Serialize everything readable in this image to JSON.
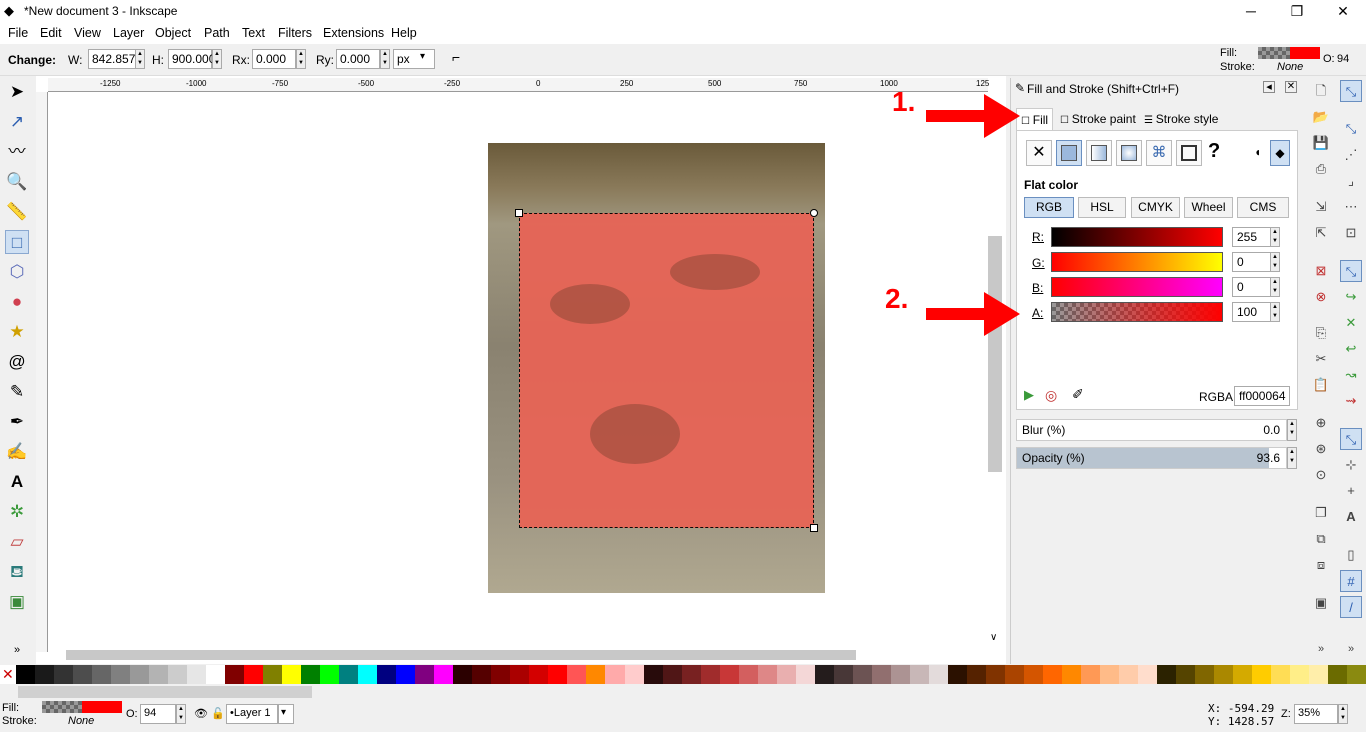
{
  "window": {
    "title": "*New document 3 - Inkscape",
    "minimize": "─",
    "maximize": "❐",
    "close": "✕"
  },
  "menu": [
    "File",
    "Edit",
    "View",
    "Layer",
    "Object",
    "Path",
    "Text",
    "Filters",
    "Extensions",
    "Help"
  ],
  "toolbar": {
    "change_label": "Change:",
    "w_label": "W:",
    "w_value": "842.857",
    "h_label": "H:",
    "h_value": "900.000",
    "rx_label": "Rx:",
    "rx_value": "0.000",
    "ry_label": "Ry:",
    "ry_value": "0.000",
    "unit": "px"
  },
  "style_indicator": {
    "fill_label": "Fill:",
    "stroke_label": "Stroke:",
    "stroke_value": "None",
    "opacity_label": "O:",
    "opacity_value": "94",
    "fill_color": "#ff0000"
  },
  "ruler": {
    "labels": [
      "-1250",
      "-1000",
      "-750",
      "-500",
      "-250",
      "0",
      "250",
      "500",
      "750",
      "1000",
      "125"
    ]
  },
  "panel": {
    "title": "Fill and Stroke (Shift+Ctrl+F)",
    "tabs": [
      "Fill",
      "Stroke paint",
      "Stroke style"
    ],
    "flat_color_label": "Flat color",
    "modes": [
      "RGB",
      "HSL",
      "CMYK",
      "Wheel",
      "CMS"
    ],
    "channels": [
      {
        "label": "R:",
        "value": "255"
      },
      {
        "label": "G:",
        "value": "0"
      },
      {
        "label": "B:",
        "value": "0"
      },
      {
        "label": "A:",
        "value": "100"
      }
    ],
    "rgba_label": "RGBA:",
    "rgba_value": "ff000064",
    "blur_label": "Blur (%)",
    "blur_value": "0.0",
    "opacity_label": "Opacity (%)",
    "opacity_value": "93.6",
    "opacity_fraction": 0.936
  },
  "annotations": {
    "one": "1.",
    "two": "2."
  },
  "statusbar": {
    "fill_label": "Fill:",
    "stroke_label": "Stroke:",
    "stroke_value": "None",
    "opacity_label": "O:",
    "opacity_value": "94",
    "layer": "•Layer 1",
    "x_coord": "X: -594.29",
    "y_coord": "Y: 1428.57",
    "zoom_label": "Z:",
    "zoom_value": "35%"
  },
  "colors": {
    "accent": "#ff0000",
    "selection_fill": "#e86456"
  }
}
